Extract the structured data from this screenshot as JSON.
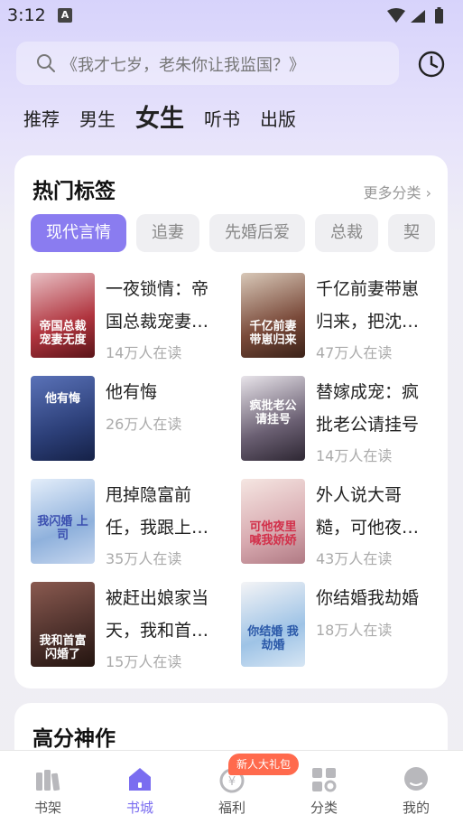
{
  "status_bar": {
    "time": "3:12",
    "notification_glyph": "A"
  },
  "search": {
    "placeholder": "《我才七岁，老朱你让我监国？》"
  },
  "channels": [
    {
      "label": "推荐",
      "active": false
    },
    {
      "label": "男生",
      "active": false
    },
    {
      "label": "女生",
      "active": true
    },
    {
      "label": "听书",
      "active": false
    },
    {
      "label": "出版",
      "active": false
    }
  ],
  "hot_tags": {
    "title": "热门标签",
    "more_label": "更多分类 ›",
    "tags": [
      "现代言情",
      "追妻",
      "先婚后爱",
      "总裁",
      "契"
    ],
    "books": [
      {
        "title": "一夜锁情：帝国总裁宠妻…",
        "readers": "14万人在读",
        "cover_text": "帝国总裁 宠妻无度",
        "cover_color": "#b0343e"
      },
      {
        "title": "千亿前妻带崽归来，把沈…",
        "readers": "47万人在读",
        "cover_text": "千亿前妻 带崽归来",
        "cover_color": "#7a4a3a"
      },
      {
        "title": "他有悔",
        "readers": "26万人在读",
        "cover_text": "他有悔",
        "cover_color": "#2c3f78"
      },
      {
        "title": "替嫁成宠：疯批老公请挂号",
        "readers": "14万人在读",
        "cover_text": "疯批老公 请挂号",
        "cover_color": "#6a5f72"
      },
      {
        "title": "甩掉隐富前任，我跟上…",
        "readers": "35万人在读",
        "cover_text": "我闪婚 上司",
        "cover_color": "#8fb1dc"
      },
      {
        "title": "外人说大哥糙，可他夜…",
        "readers": "43万人在读",
        "cover_text": "可他夜里 喊我娇娇",
        "cover_color": "#d8aab0"
      },
      {
        "title": "被赶出娘家当天，我和首…",
        "readers": "15万人在读",
        "cover_text": "我和首富 闪婚了",
        "cover_color": "#4b2f2a"
      },
      {
        "title": "你结婚我劫婚",
        "readers": "18万人在读",
        "cover_text": "你结婚 我劫婚",
        "cover_color": "#9ec3e6"
      }
    ]
  },
  "high_score": {
    "title": "高分神作"
  },
  "bottom_nav": {
    "badge": "新人大礼包",
    "items": [
      {
        "label": "书架",
        "icon": "bookshelf-icon",
        "active": false
      },
      {
        "label": "书城",
        "icon": "bookstore-icon",
        "active": true
      },
      {
        "label": "福利",
        "icon": "welfare-icon",
        "active": false
      },
      {
        "label": "分类",
        "icon": "category-icon",
        "active": false
      },
      {
        "label": "我的",
        "icon": "profile-icon",
        "active": false
      }
    ]
  },
  "colors": {
    "accent": "#7a6df0",
    "tag_active": "#8a7cf0",
    "badge": "#ff6a4d"
  }
}
